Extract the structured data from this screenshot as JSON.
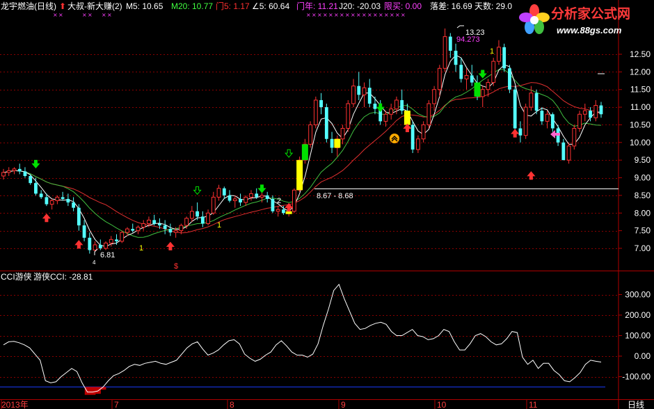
{
  "header": {
    "title": "龙宇燃油(日线)",
    "strategy": "大叔-新大赚(2)",
    "m5": "M5: 10.65",
    "m20": "M20: 10.77",
    "men5": "门5: 1.17",
    "angle5": "∠5: 60.64",
    "menyear": "门年: 11.21",
    "j20": "J20: -20.03",
    "limit_buy": "限买: 0.00",
    "drop": "落差: 16.69",
    "days": "天数: 29.0"
  },
  "logo": {
    "name": "分析家公式网",
    "url": "www.88gs.com"
  },
  "colors": {
    "background": "#000000",
    "up_candle": "#ff3232",
    "down_candle": "#54ffff",
    "ma5": "#ffffff",
    "ma_red": "#e03030",
    "ma_green": "#40c040",
    "yellow_bar": "#ffff00",
    "green_bar": "#00e000",
    "cci_line": "#ffffff",
    "cci_blue_line": "#1a3cff",
    "cci_red_fill": "#c00000",
    "grid": "#8b0000",
    "axis_text": "#ffffff"
  },
  "annotations": {
    "high_label": "13.23",
    "high_value": "94.273",
    "low_label": "6.81",
    "range_label": "8.67 - 8.68",
    "num_1a": "1",
    "num_1b": "1",
    "num_2": "2",
    "num_1c": "1",
    "dollar": "$",
    "small_4": "4"
  },
  "indicator": {
    "name": "CCI游侠",
    "label": "游侠CCI: -28.81"
  },
  "x_axis": {
    "labels": [
      "2013年",
      "7",
      "8",
      "9",
      "10",
      "11"
    ],
    "period": "日线"
  },
  "chart_data": [
    {
      "type": "candlestick",
      "ylim": [
        6.45,
        13.5
      ],
      "yticks": [
        7.0,
        7.5,
        8.0,
        8.5,
        9.0,
        9.5,
        10.0,
        10.5,
        11.0,
        11.5,
        12.0,
        12.5
      ],
      "ytick_labels": [
        "7.00",
        "7.50",
        "8.00",
        "8.50",
        "9.00",
        "9.50",
        "10.00",
        "10.50",
        "11.00",
        "11.50",
        "12.00",
        "12.50"
      ],
      "reference_price": 8.69,
      "candles": [
        {
          "o": 9.05,
          "h": 9.25,
          "l": 8.95,
          "c": 9.15
        },
        {
          "o": 9.15,
          "h": 9.3,
          "l": 9.05,
          "c": 9.2
        },
        {
          "o": 9.2,
          "h": 9.3,
          "l": 9.1,
          "c": 9.25
        },
        {
          "o": 9.25,
          "h": 9.4,
          "l": 9.1,
          "c": 9.18
        },
        {
          "o": 9.18,
          "h": 9.3,
          "l": 9.0,
          "c": 9.05
        },
        {
          "o": 9.05,
          "h": 9.1,
          "l": 8.8,
          "c": 8.85
        },
        {
          "o": 8.85,
          "h": 9.0,
          "l": 8.5,
          "c": 8.55
        },
        {
          "o": 8.55,
          "h": 8.65,
          "l": 8.4,
          "c": 8.45
        },
        {
          "o": 8.45,
          "h": 8.55,
          "l": 8.2,
          "c": 8.25
        },
        {
          "o": 8.25,
          "h": 8.4,
          "l": 8.1,
          "c": 8.35
        },
        {
          "o": 8.35,
          "h": 8.5,
          "l": 8.25,
          "c": 8.45
        },
        {
          "o": 8.45,
          "h": 8.6,
          "l": 8.35,
          "c": 8.4
        },
        {
          "o": 8.4,
          "h": 8.55,
          "l": 8.2,
          "c": 8.3
        },
        {
          "o": 8.3,
          "h": 8.45,
          "l": 8.05,
          "c": 8.15
        },
        {
          "o": 8.15,
          "h": 8.25,
          "l": 7.5,
          "c": 7.65
        },
        {
          "o": 7.65,
          "h": 7.8,
          "l": 7.2,
          "c": 7.3
        },
        {
          "o": 7.3,
          "h": 7.45,
          "l": 6.85,
          "c": 6.95
        },
        {
          "o": 6.95,
          "h": 7.2,
          "l": 6.9,
          "c": 7.1
        },
        {
          "o": 7.1,
          "h": 7.25,
          "l": 6.95,
          "c": 7.0
        },
        {
          "o": 7.0,
          "h": 7.2,
          "l": 6.95,
          "c": 7.15
        },
        {
          "o": 7.15,
          "h": 7.35,
          "l": 7.05,
          "c": 7.25
        },
        {
          "o": 7.25,
          "h": 7.4,
          "l": 7.1,
          "c": 7.2
        },
        {
          "o": 7.2,
          "h": 7.5,
          "l": 7.15,
          "c": 7.45
        },
        {
          "o": 7.45,
          "h": 7.6,
          "l": 7.35,
          "c": 7.55
        },
        {
          "o": 7.55,
          "h": 7.7,
          "l": 7.45,
          "c": 7.5
        },
        {
          "o": 7.5,
          "h": 7.65,
          "l": 7.4,
          "c": 7.6
        },
        {
          "o": 7.6,
          "h": 7.8,
          "l": 7.5,
          "c": 7.7
        },
        {
          "o": 7.7,
          "h": 7.9,
          "l": 7.6,
          "c": 7.8
        },
        {
          "o": 7.8,
          "h": 7.95,
          "l": 7.65,
          "c": 7.7
        },
        {
          "o": 7.7,
          "h": 7.85,
          "l": 7.55,
          "c": 7.65
        },
        {
          "o": 7.65,
          "h": 7.8,
          "l": 7.4,
          "c": 7.55
        },
        {
          "o": 7.55,
          "h": 7.7,
          "l": 7.35,
          "c": 7.45
        },
        {
          "o": 7.45,
          "h": 7.6,
          "l": 7.3,
          "c": 7.5
        },
        {
          "o": 7.5,
          "h": 7.7,
          "l": 7.4,
          "c": 7.65
        },
        {
          "o": 7.65,
          "h": 7.9,
          "l": 7.55,
          "c": 7.85
        },
        {
          "o": 7.85,
          "h": 8.2,
          "l": 7.75,
          "c": 8.05
        },
        {
          "o": 8.05,
          "h": 8.3,
          "l": 7.8,
          "c": 7.9
        },
        {
          "o": 7.9,
          "h": 8.05,
          "l": 7.6,
          "c": 7.7
        },
        {
          "o": 7.7,
          "h": 8.1,
          "l": 7.65,
          "c": 8.0
        },
        {
          "o": 8.0,
          "h": 8.6,
          "l": 7.95,
          "c": 8.45
        },
        {
          "o": 8.45,
          "h": 8.8,
          "l": 8.35,
          "c": 8.7
        },
        {
          "o": 8.7,
          "h": 8.75,
          "l": 8.4,
          "c": 8.5
        },
        {
          "o": 8.5,
          "h": 8.65,
          "l": 8.3,
          "c": 8.35
        },
        {
          "o": 8.35,
          "h": 8.5,
          "l": 8.15,
          "c": 8.4
        },
        {
          "o": 8.4,
          "h": 8.55,
          "l": 8.2,
          "c": 8.3
        },
        {
          "o": 8.3,
          "h": 8.5,
          "l": 8.2,
          "c": 8.45
        },
        {
          "o": 8.45,
          "h": 8.65,
          "l": 8.35,
          "c": 8.55
        },
        {
          "o": 8.55,
          "h": 8.7,
          "l": 8.4,
          "c": 8.45
        },
        {
          "o": 8.45,
          "h": 8.6,
          "l": 8.3,
          "c": 8.5
        },
        {
          "o": 8.5,
          "h": 8.6,
          "l": 8.3,
          "c": 8.4
        },
        {
          "o": 8.4,
          "h": 8.5,
          "l": 8.0,
          "c": 8.05
        },
        {
          "o": 8.05,
          "h": 8.2,
          "l": 7.9,
          "c": 8.1
        },
        {
          "o": 8.1,
          "h": 8.2,
          "l": 7.95,
          "c": 8.0
        },
        {
          "o": 8.0,
          "h": 8.15,
          "l": 7.9,
          "c": 8.05
        },
        {
          "o": 8.05,
          "h": 8.7,
          "l": 8.0,
          "c": 8.65
        },
        {
          "o": 8.65,
          "h": 9.6,
          "l": 8.6,
          "c": 9.5
        },
        {
          "o": 9.5,
          "h": 10.1,
          "l": 9.4,
          "c": 9.95
        },
        {
          "o": 9.95,
          "h": 10.6,
          "l": 9.85,
          "c": 10.5
        },
        {
          "o": 10.5,
          "h": 11.3,
          "l": 10.4,
          "c": 11.2
        },
        {
          "o": 11.2,
          "h": 11.4,
          "l": 10.8,
          "c": 11.0
        },
        {
          "o": 11.0,
          "h": 11.1,
          "l": 10.0,
          "c": 10.1
        },
        {
          "o": 10.1,
          "h": 10.3,
          "l": 9.7,
          "c": 9.85
        },
        {
          "o": 9.85,
          "h": 10.2,
          "l": 9.6,
          "c": 10.1
        },
        {
          "o": 10.1,
          "h": 10.5,
          "l": 9.95,
          "c": 10.4
        },
        {
          "o": 10.4,
          "h": 11.2,
          "l": 10.3,
          "c": 11.1
        },
        {
          "o": 11.1,
          "h": 11.8,
          "l": 11.0,
          "c": 11.6
        },
        {
          "o": 11.6,
          "h": 12.0,
          "l": 11.2,
          "c": 11.35
        },
        {
          "o": 11.35,
          "h": 11.7,
          "l": 11.0,
          "c": 11.55
        },
        {
          "o": 11.55,
          "h": 11.8,
          "l": 11.0,
          "c": 11.1
        },
        {
          "o": 11.1,
          "h": 11.3,
          "l": 10.8,
          "c": 10.95
        },
        {
          "o": 10.95,
          "h": 11.2,
          "l": 10.5,
          "c": 10.6
        },
        {
          "o": 10.6,
          "h": 10.9,
          "l": 10.45,
          "c": 10.8
        },
        {
          "o": 10.8,
          "h": 11.1,
          "l": 10.65,
          "c": 10.95
        },
        {
          "o": 10.95,
          "h": 11.3,
          "l": 10.8,
          "c": 11.2
        },
        {
          "o": 11.2,
          "h": 11.5,
          "l": 10.8,
          "c": 10.9
        },
        {
          "o": 10.9,
          "h": 11.1,
          "l": 10.4,
          "c": 10.5
        },
        {
          "o": 10.5,
          "h": 10.6,
          "l": 9.7,
          "c": 9.8
        },
        {
          "o": 9.8,
          "h": 10.2,
          "l": 9.7,
          "c": 10.1
        },
        {
          "o": 10.1,
          "h": 10.6,
          "l": 10.0,
          "c": 10.5
        },
        {
          "o": 10.5,
          "h": 11.2,
          "l": 10.4,
          "c": 11.1
        },
        {
          "o": 11.1,
          "h": 11.6,
          "l": 10.9,
          "c": 11.5
        },
        {
          "o": 11.5,
          "h": 12.2,
          "l": 11.3,
          "c": 12.1
        },
        {
          "o": 12.1,
          "h": 13.23,
          "l": 12.0,
          "c": 13.0
        },
        {
          "o": 13.0,
          "h": 13.1,
          "l": 12.4,
          "c": 12.6
        },
        {
          "o": 12.6,
          "h": 12.8,
          "l": 12.0,
          "c": 12.2
        },
        {
          "o": 12.2,
          "h": 12.4,
          "l": 11.7,
          "c": 11.8
        },
        {
          "o": 11.8,
          "h": 12.1,
          "l": 11.5,
          "c": 11.9
        },
        {
          "o": 11.9,
          "h": 12.2,
          "l": 11.6,
          "c": 11.7
        },
        {
          "o": 11.7,
          "h": 11.9,
          "l": 11.2,
          "c": 11.3
        },
        {
          "o": 11.3,
          "h": 11.6,
          "l": 11.0,
          "c": 11.5
        },
        {
          "o": 11.5,
          "h": 11.8,
          "l": 11.3,
          "c": 11.7
        },
        {
          "o": 11.7,
          "h": 12.4,
          "l": 11.6,
          "c": 12.3
        },
        {
          "o": 12.3,
          "h": 12.9,
          "l": 12.2,
          "c": 12.7
        },
        {
          "o": 12.7,
          "h": 12.8,
          "l": 12.0,
          "c": 12.1
        },
        {
          "o": 12.1,
          "h": 12.2,
          "l": 11.4,
          "c": 11.5
        },
        {
          "o": 11.5,
          "h": 11.6,
          "l": 10.3,
          "c": 10.4
        },
        {
          "o": 10.4,
          "h": 10.6,
          "l": 10.0,
          "c": 10.2
        },
        {
          "o": 10.2,
          "h": 11.1,
          "l": 10.1,
          "c": 11.0
        },
        {
          "o": 11.0,
          "h": 11.6,
          "l": 10.9,
          "c": 11.4
        },
        {
          "o": 11.4,
          "h": 11.5,
          "l": 10.8,
          "c": 10.9
        },
        {
          "o": 10.9,
          "h": 11.0,
          "l": 10.5,
          "c": 10.6
        },
        {
          "o": 10.6,
          "h": 10.9,
          "l": 10.4,
          "c": 10.8
        },
        {
          "o": 10.8,
          "h": 10.85,
          "l": 10.3,
          "c": 10.4
        },
        {
          "o": 10.4,
          "h": 10.5,
          "l": 9.9,
          "c": 10.0
        },
        {
          "o": 10.0,
          "h": 10.1,
          "l": 9.5,
          "c": 9.5
        },
        {
          "o": 9.5,
          "h": 10.0,
          "l": 9.4,
          "c": 9.9
        },
        {
          "o": 9.9,
          "h": 10.5,
          "l": 9.8,
          "c": 10.4
        },
        {
          "o": 10.4,
          "h": 10.9,
          "l": 10.3,
          "c": 10.8
        },
        {
          "o": 10.8,
          "h": 11.1,
          "l": 10.6,
          "c": 10.9
        },
        {
          "o": 10.9,
          "h": 11.0,
          "l": 10.6,
          "c": 10.7
        },
        {
          "o": 10.7,
          "h": 11.2,
          "l": 10.6,
          "c": 11.05
        },
        {
          "o": 11.05,
          "h": 11.15,
          "l": 10.7,
          "c": 10.8
        }
      ]
    },
    {
      "type": "line",
      "name": "CCI",
      "ylim": [
        -175,
        380
      ],
      "yticks": [
        -100,
        0,
        100,
        200,
        300
      ],
      "ytick_labels": [
        "-100.00",
        "0.00",
        "100.00",
        "200.00",
        "300.00"
      ],
      "threshold": -150,
      "values": [
        55,
        70,
        72,
        65,
        55,
        40,
        10,
        -20,
        -120,
        -130,
        -125,
        -100,
        -80,
        -60,
        -75,
        -130,
        -175,
        -175,
        -170,
        -150,
        -120,
        -95,
        -85,
        -70,
        -50,
        -40,
        -45,
        -35,
        -30,
        -25,
        -35,
        -40,
        -30,
        -20,
        10,
        40,
        60,
        70,
        35,
        5,
        15,
        30,
        55,
        75,
        80,
        60,
        10,
        -10,
        -25,
        -15,
        5,
        20,
        55,
        75,
        50,
        20,
        5,
        5,
        -5,
        10,
        60,
        150,
        230,
        320,
        350,
        280,
        220,
        160,
        130,
        135,
        150,
        160,
        165,
        155,
        120,
        100,
        100,
        115,
        130,
        100,
        95,
        80,
        85,
        100,
        130,
        120,
        70,
        30,
        30,
        60,
        100,
        110,
        95,
        70,
        55,
        60,
        85,
        120,
        115,
        -5,
        -40,
        -20,
        -60,
        -35,
        -35,
        -70,
        -90,
        -120,
        -125,
        -105,
        -80,
        -40,
        -20,
        -25,
        -28.81
      ]
    }
  ]
}
